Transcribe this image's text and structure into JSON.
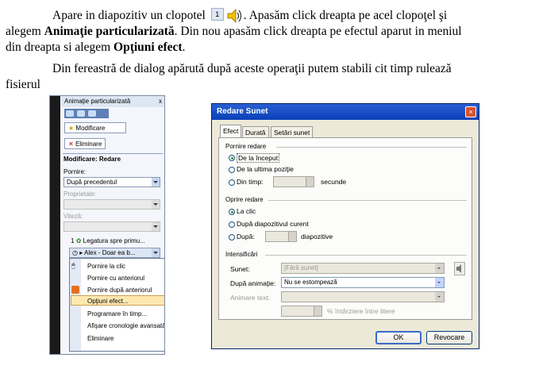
{
  "text": {
    "p1_part1": "Apare in diapozitiv un clopotel",
    "p1_part2": ". Apasăm click dreapta pe acel clopoţel şi",
    "p1_line2_a": "alegem ",
    "p1_line2_bold": "Animaţie particularizată",
    "p1_line2_b": ". Din nou apasăm click dreapta pe efectul aparut in meniul",
    "p1_line3_a": "din dreapta si alegem ",
    "p1_line3_bold": "Opţiuni efect",
    "p1_line3_b": ".",
    "p2_line1": "Din fereastră de dialog apărută după aceste operaţii putem stabili cit timp rulează",
    "p2_line2": "fisierul",
    "slide_number": "1"
  },
  "panel": {
    "title": "Animaţie particularizată",
    "close": "x",
    "modify_button": "Modificare",
    "remove_button": "Eliminare",
    "modify_heading": "Modificare: Redare",
    "start_label": "Pornire:",
    "start_value": "După precedentul",
    "property_label": "Proprietate:",
    "speed_label": "Viteză:",
    "item1": "Legatura spre primu...",
    "item2": "Alex - Doar ea b...",
    "item_number": "1",
    "context_menu": [
      "Pornire la clic",
      "Pornire cu anteriorul",
      "Pornire după anteriorul",
      "Opţiuni efect...",
      "Programare în timp...",
      "Afişare cronologie avansată",
      "Eliminare"
    ]
  },
  "dialog": {
    "title": "Redare Sunet",
    "close": "×",
    "tabs": [
      "Efect",
      "Durată",
      "Setări sunet"
    ],
    "start_group": "Pornire redare",
    "start_options": [
      "De la început",
      "De la ultima poziţie",
      "Din timp:"
    ],
    "start_seconds_unit": "secunde",
    "stop_group": "Oprire redare",
    "stop_options": [
      "La clic",
      "După diapozitivul curent",
      "După:"
    ],
    "stop_unit": "diapozitive",
    "enh_group": "Intensificări",
    "sound_label": "Sunet:",
    "sound_value": "[Fără sunet]",
    "after_label": "După animaţie:",
    "after_value": "Nu se estompează",
    "anim_text_label": "Animare text:",
    "delay_label": "% întârziere între litere",
    "ok": "OK",
    "cancel": "Revocare"
  },
  "colors": {
    "title_bar": "#0a3fb8",
    "dialog_bg": "#ece9d8",
    "highlight": "#ffe8b0"
  }
}
